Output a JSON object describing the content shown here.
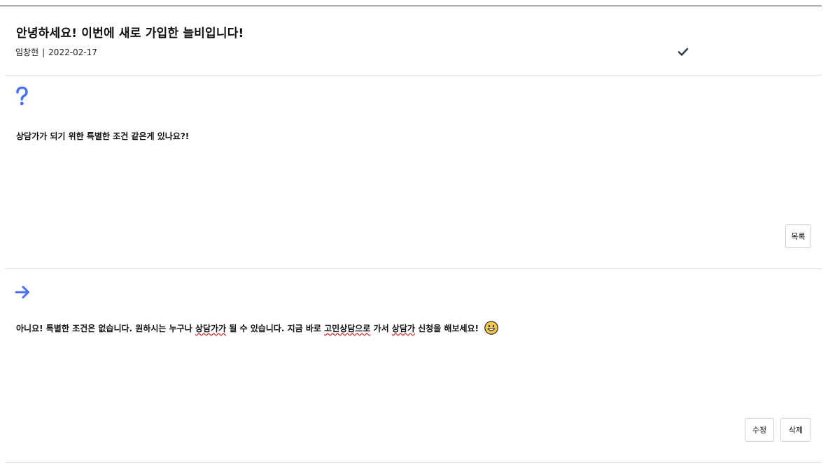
{
  "post": {
    "title": "안녕하세요! 이번에 새로 가입한 늘비입니다!",
    "author": "임창현",
    "separator": "|",
    "date": "2022-02-17"
  },
  "question": {
    "icon": "question-mark-icon",
    "text": "상담가가 되기 위한 특별한 조건 같은게 있나요?!",
    "list_button_label": "목록"
  },
  "answer": {
    "icon": "arrow-right-icon",
    "text_parts": [
      "아니요! 특별한 조건은 없습니다. 원하시는 누구나 ",
      "상담가가",
      " 될 수 있습니다. 지금 바로 ",
      "고민상담으로",
      " 가서 ",
      "상담가",
      " 신청을 해보세요!"
    ],
    "emoji": "grinning-face-emoji",
    "edit_button_label": "수정",
    "delete_button_label": "삭제"
  },
  "colors": {
    "accent_blue": "#4a72f5",
    "check_dark": "#2f3e52",
    "divider": "#dddddd",
    "spellcheck_red": "#d22222"
  }
}
